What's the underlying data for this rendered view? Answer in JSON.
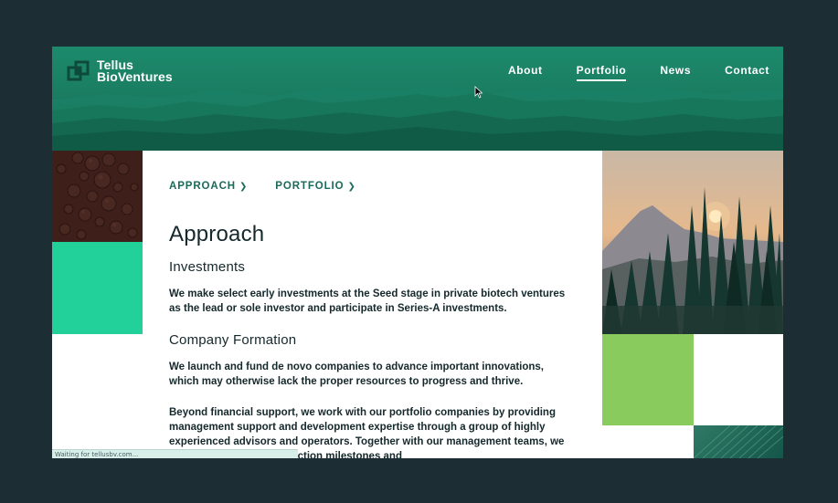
{
  "brand": {
    "line1": "Tellus",
    "line2": "BioVentures"
  },
  "nav": {
    "items": [
      {
        "label": "About",
        "active": false
      },
      {
        "label": "Portfolio",
        "active": true
      },
      {
        "label": "News",
        "active": false
      },
      {
        "label": "Contact",
        "active": false
      }
    ]
  },
  "subnav": {
    "approach": "APPROACH",
    "portfolio": "PORTFOLIO"
  },
  "main": {
    "title": "Approach",
    "investments_title": "Investments",
    "investments_text": "We make select early investments at the Seed stage in private biotech ventures as the lead or sole investor and participate in Series-A investments.",
    "formation_title": "Company Formation",
    "formation_text": "We launch and fund de novo companies to advance important innovations, which may otherwise lack the proper resources to progress and thrive.",
    "support_text": "Beyond financial support, we work with our portfolio companies by providing management support and development expertise through a group of highly experienced advisors and operators. Together with our management teams, we identify critical value inflection milestones and"
  },
  "status": {
    "text": "Waiting for tellusbv.com..."
  },
  "colors": {
    "background": "#1c2e33",
    "header": "#1a7d62",
    "accent_teal": "#22d199",
    "accent_green": "#8acb5e",
    "text": "#15282c",
    "link": "#1a6a58"
  },
  "icons": {
    "logo": "interlocking-squares-icon",
    "chevron": "chevron-right-icon",
    "cursor": "mouse-pointer-icon"
  }
}
